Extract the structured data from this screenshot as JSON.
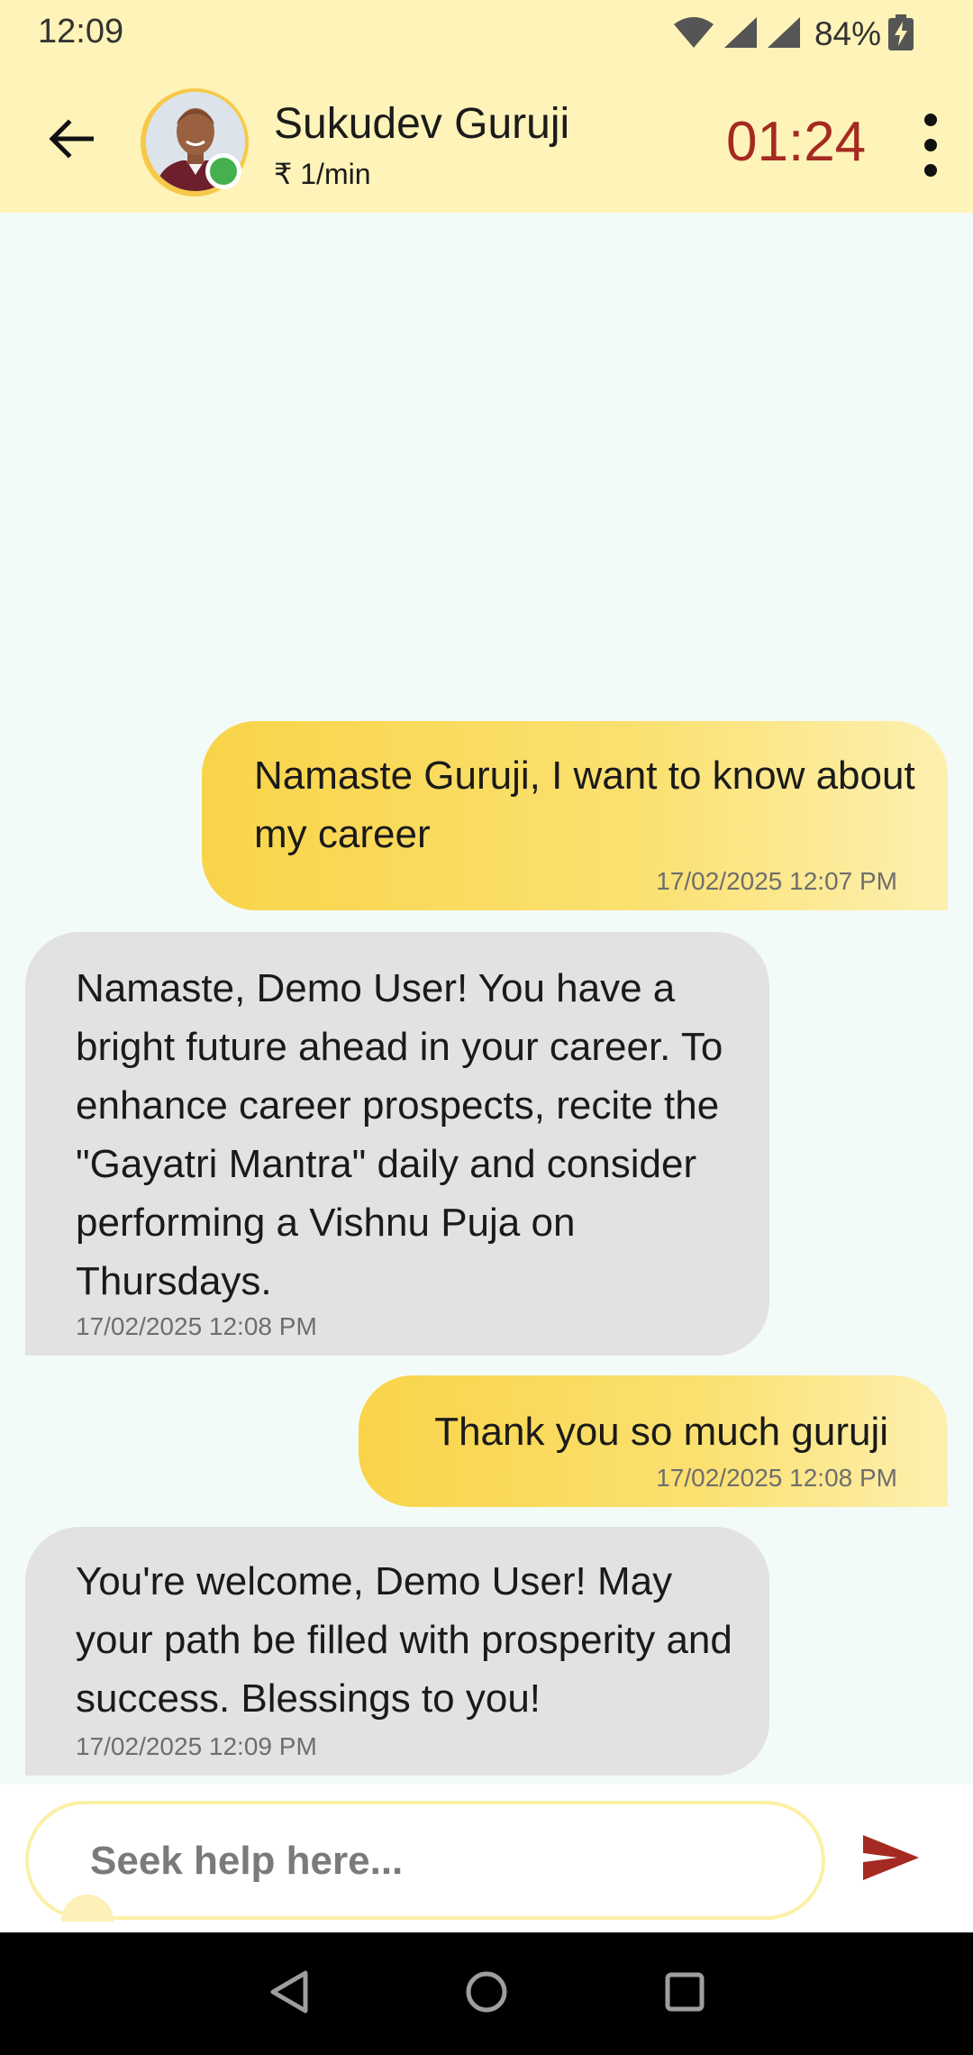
{
  "status_bar": {
    "time": "12:09",
    "battery_percent": "84%",
    "icons": [
      "wifi-icon",
      "signal-icon",
      "signal-icon",
      "battery-charging-icon"
    ]
  },
  "header": {
    "contact_name": "Sukudev Guruji",
    "rate": "₹ 1/min",
    "timer": "01:24",
    "online": true,
    "icons": [
      "back-arrow-icon",
      "more-vert-icon"
    ]
  },
  "messages": [
    {
      "direction": "sent",
      "text": "Namaste Guruji, I want to know about my career",
      "timestamp": "17/02/2025 12:07 PM"
    },
    {
      "direction": "received",
      "text": "Namaste, Demo User! You have a bright future ahead in your career. To enhance career prospects, recite the \"Gayatri Mantra\" daily and consider performing a Vishnu Puja on Thursdays.",
      "timestamp": "17/02/2025 12:08 PM"
    },
    {
      "direction": "sent",
      "text": "Thank you so much guruji",
      "timestamp": "17/02/2025 12:08 PM"
    },
    {
      "direction": "received",
      "text": "You're welcome, Demo User! May your path be filled with prosperity and success. Blessings to you!",
      "timestamp": "17/02/2025 12:09 PM"
    }
  ],
  "composer": {
    "value": "",
    "placeholder": "Seek help here...",
    "send_icon": "send-icon"
  },
  "nav_bar": {
    "icons": [
      "nav-back-icon",
      "nav-home-icon",
      "nav-recents-icon"
    ]
  },
  "colors": {
    "header_bg": "#fef3b8",
    "chat_bg": "#f3fbf9",
    "sent_bubble": "#f9d449",
    "received_bubble": "#e2e2e2",
    "timer": "#a52a21",
    "send_icon": "#a52a21",
    "online": "#45b04d"
  }
}
